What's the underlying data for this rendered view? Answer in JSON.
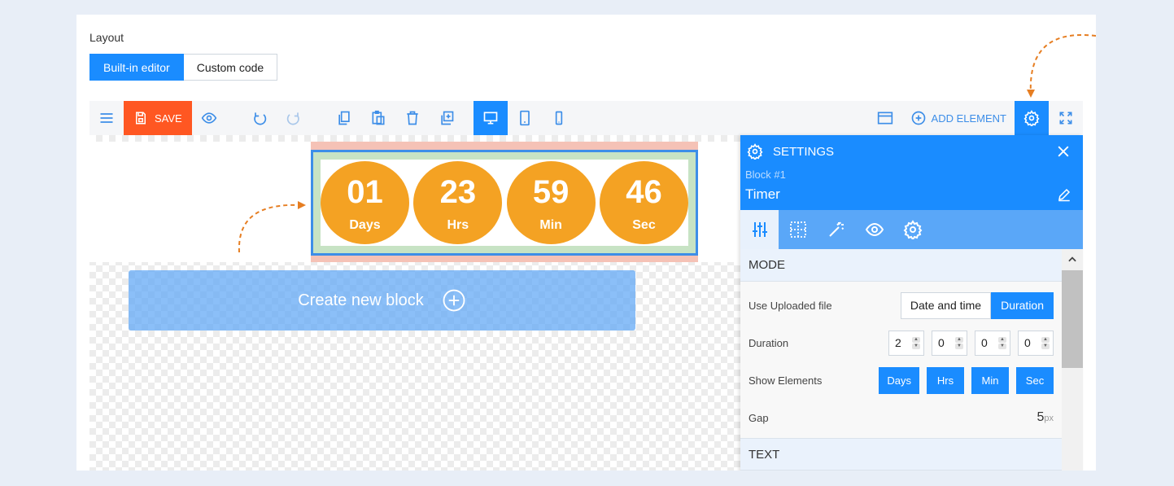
{
  "layout": {
    "label": "Layout",
    "modes": [
      "Built-in editor",
      "Custom code"
    ],
    "active_mode": "Built-in editor"
  },
  "toolbar": {
    "save_label": "SAVE",
    "add_element_label": "ADD ELEMENT",
    "icons": [
      "menu-icon",
      "save-icon",
      "eye-icon",
      "undo-icon",
      "redo-icon",
      "copy-icon",
      "paste-icon",
      "trash-icon",
      "duplicate-icon",
      "desktop-icon",
      "tablet-icon",
      "mobile-icon",
      "window-icon",
      "add-element-icon",
      "gear-icon",
      "fullscreen-icon"
    ],
    "active_device": "desktop"
  },
  "canvas": {
    "timer": [
      {
        "value": "01",
        "label": "Days"
      },
      {
        "value": "23",
        "label": "Hrs"
      },
      {
        "value": "59",
        "label": "Min"
      },
      {
        "value": "46",
        "label": "Sec"
      }
    ],
    "create_block_label": "Create new block"
  },
  "settings": {
    "title": "SETTINGS",
    "block_number": "Block #1",
    "block_name": "Timer",
    "tabs": [
      "sliders-icon",
      "grid-icon",
      "magic-wand-icon",
      "eye-icon",
      "gear-icon"
    ],
    "mode_section": "MODE",
    "use_uploaded_label": "Use Uploaded file",
    "mode_options": [
      "Date and time",
      "Duration"
    ],
    "active_mode_option": "Duration",
    "duration_label": "Duration",
    "duration_values": [
      "2",
      "0",
      "0",
      "0"
    ],
    "show_elements_label": "Show Elements",
    "show_elements": [
      "Days",
      "Hrs",
      "Min",
      "Sec"
    ],
    "gap_label": "Gap",
    "gap_value": "5",
    "gap_unit": "px",
    "text_section": "TEXT"
  },
  "colors": {
    "primary": "#1a8cff",
    "save": "#ff5722",
    "timer_circle": "#f4a223",
    "arrow": "#e67e22"
  }
}
